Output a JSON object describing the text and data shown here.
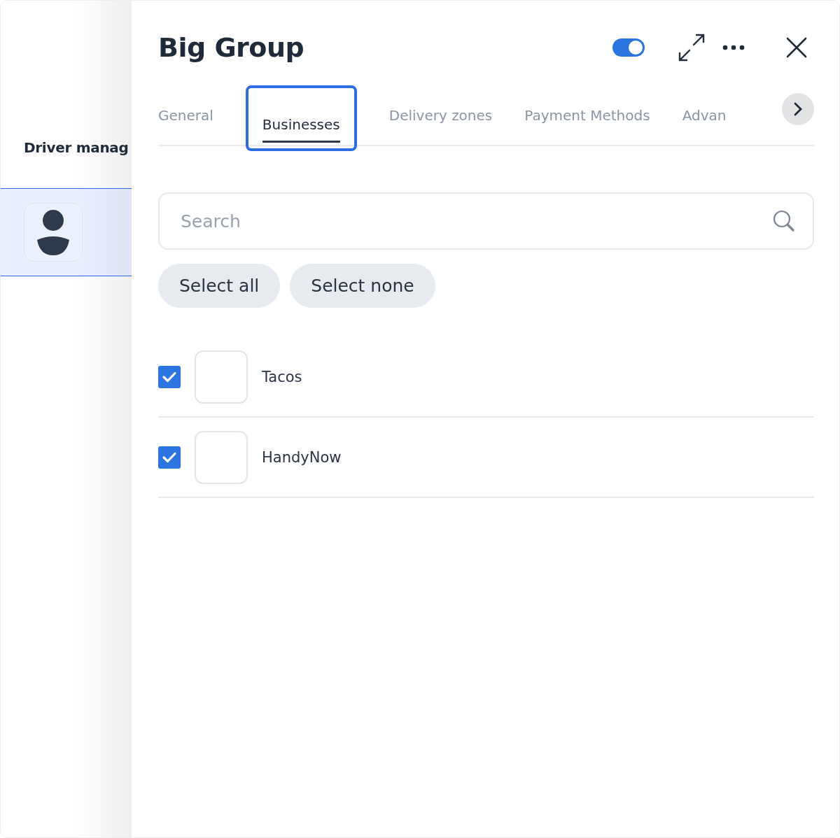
{
  "background_page": {
    "section_title": "Driver manag",
    "avatar_row_selected": true
  },
  "panel": {
    "title": "Big Group",
    "toggle_on": true
  },
  "tabs": [
    {
      "label": "General",
      "selected": false
    },
    {
      "label": "Businesses",
      "selected": true
    },
    {
      "label": "Delivery zones",
      "selected": false
    },
    {
      "label": "Payment Methods",
      "selected": false
    },
    {
      "label": "Advan",
      "selected": false
    }
  ],
  "search": {
    "placeholder": "Search"
  },
  "buttons": [
    "Select all",
    "Select none"
  ],
  "businesses": [
    {
      "name": "Tacos",
      "checked": true
    },
    {
      "name": "HandyNow",
      "checked": true
    }
  ]
}
